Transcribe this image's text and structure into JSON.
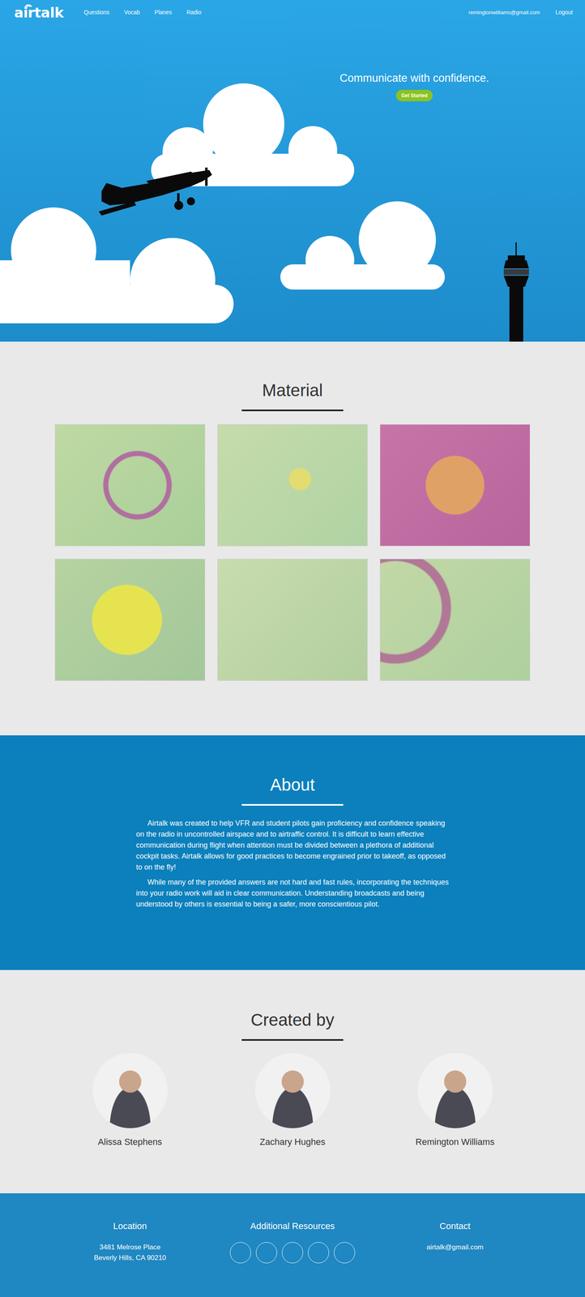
{
  "nav": {
    "logo": "airtalk",
    "items": [
      {
        "label": "Questions"
      },
      {
        "label": "Vocab"
      },
      {
        "label": "Planes"
      },
      {
        "label": "Radio"
      }
    ],
    "user": "remingtonwilliams@gmail.com",
    "logout": "Logout"
  },
  "hero": {
    "heading": "Communicate with confidence.",
    "button": "Get Started"
  },
  "material": {
    "title": "Material",
    "maps": [
      {},
      {},
      {},
      {},
      {},
      {}
    ]
  },
  "about": {
    "title": "About",
    "paragraphs": [
      "Airtalk was created to help VFR and student pilots gain proficiency and confidence speaking on the radio in uncontrolled airspace and to airtraffic control. It is difficult to learn effective communication during flight when attention must be divided between a plethora of additional cockpit tasks. Airtalk allows for good practices to become engrained prior to takeoff, as opposed to on the fly!",
      "While many of the provided answers are not hard and fast rules, incorporating the techniques into your radio work will aid in clear communication. Understanding broadcasts and being understood by others is essential to being a safer, more conscientious pilot."
    ]
  },
  "creators": {
    "title": "Created by",
    "people": [
      {
        "name": "Alissa Stephens"
      },
      {
        "name": "Zachary Hughes"
      },
      {
        "name": "Remington Williams"
      }
    ]
  },
  "footer": {
    "location": {
      "title": "Location",
      "lines": [
        "3481 Melrose Place",
        "Beverly Hills, CA 90210"
      ]
    },
    "resources": {
      "title": "Additional Resources",
      "links": [
        {},
        {},
        {},
        {},
        {}
      ]
    },
    "contact": {
      "title": "Contact",
      "email": "airtalk@gmail.com"
    }
  }
}
